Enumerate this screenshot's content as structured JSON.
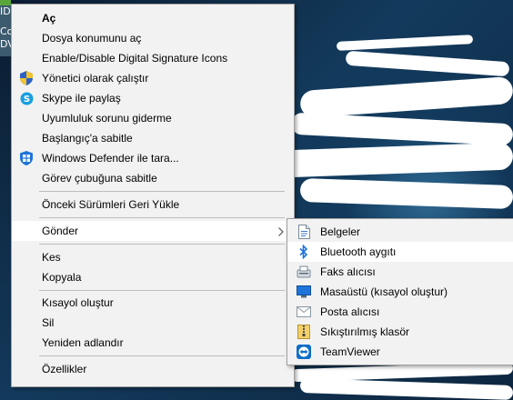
{
  "desktop": {
    "icon_text_1": "IDE",
    "icon_text_2": "Co",
    "icon_text_3": "DV"
  },
  "context_menu": {
    "items": [
      {
        "label": "Aç",
        "bold": true,
        "icon": ""
      },
      {
        "label": "Dosya konumunu aç",
        "icon": ""
      },
      {
        "label": "Enable/Disable Digital Signature Icons",
        "icon": ""
      },
      {
        "label": "Yönetici olarak çalıştır",
        "icon": "uac-shield-icon"
      },
      {
        "label": "Skype ile paylaş",
        "icon": "skype-icon"
      },
      {
        "label": "Uyumluluk sorunu giderme",
        "icon": ""
      },
      {
        "label": "Başlangıç'a sabitle",
        "icon": ""
      },
      {
        "label": "Windows Defender ile tara...",
        "icon": "windows-defender-icon"
      },
      {
        "label": "Görev çubuğuna sabitle",
        "icon": ""
      },
      {
        "label": "Önceki Sürümleri Geri Yükle",
        "icon": ""
      },
      {
        "label": "Gönder",
        "icon": "",
        "submenu": true,
        "highlighted": true
      },
      {
        "label": "Kes",
        "icon": ""
      },
      {
        "label": "Kopyala",
        "icon": ""
      },
      {
        "label": "Kısayol oluştur",
        "icon": ""
      },
      {
        "label": "Sil",
        "icon": ""
      },
      {
        "label": "Yeniden adlandır",
        "icon": ""
      },
      {
        "label": "Özellikler",
        "icon": ""
      }
    ]
  },
  "send_to_menu": {
    "items": [
      {
        "label": "Belgeler",
        "icon": "document-icon"
      },
      {
        "label": "Bluetooth aygıtı",
        "icon": "bluetooth-icon",
        "highlighted": true
      },
      {
        "label": "Faks alıcısı",
        "icon": "fax-icon"
      },
      {
        "label": "Masaüstü (kısayol oluştur)",
        "icon": "desktop-icon"
      },
      {
        "label": "Posta alıcısı",
        "icon": "mail-icon"
      },
      {
        "label": "Sıkıştırılmış klasör",
        "icon": "zip-folder-icon"
      },
      {
        "label": "TeamViewer",
        "icon": "teamviewer-icon"
      }
    ]
  },
  "colors": {
    "menu_bg": "#f2f2f2",
    "highlight": "#ffffff",
    "accent_blue": "#1e74d8"
  }
}
